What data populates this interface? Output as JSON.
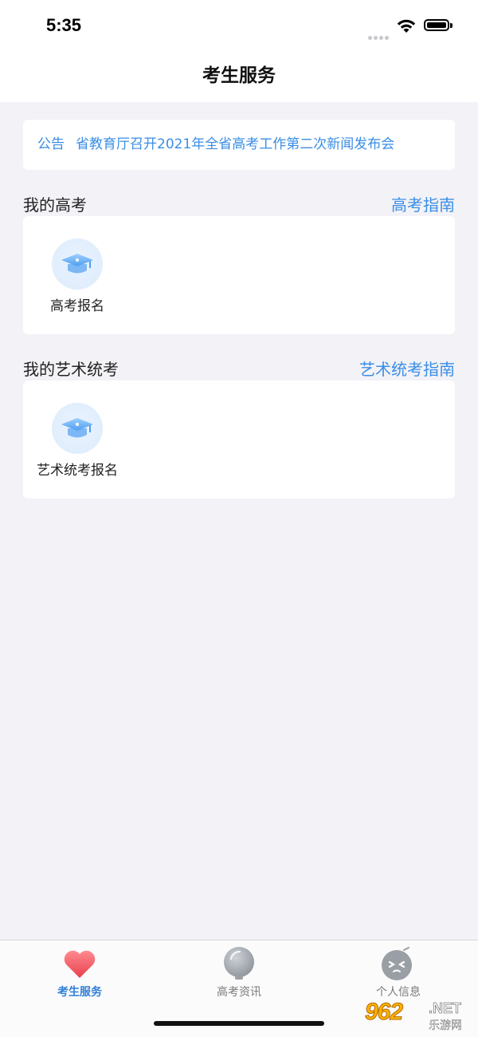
{
  "status_bar": {
    "time": "5:35"
  },
  "nav": {
    "title": "考生服务"
  },
  "notice": {
    "tag": "公告",
    "text": "省教育厅召开2021年全省高考工作第二次新闻发布会"
  },
  "sections": [
    {
      "title": "我的高考",
      "link": "高考指南",
      "entries": [
        {
          "label": "高考报名",
          "icon": "graduation-cap-icon"
        }
      ]
    },
    {
      "title": "我的艺术统考",
      "link": "艺术统考指南",
      "entries": [
        {
          "label": "艺术统考报名",
          "icon": "graduation-cap-icon"
        }
      ]
    }
  ],
  "tabbar": {
    "items": [
      {
        "label": "考生服务",
        "icon": "heart-icon",
        "active": true
      },
      {
        "label": "高考资讯",
        "icon": "lightbulb-icon",
        "active": false
      },
      {
        "label": "个人信息",
        "icon": "face-icon",
        "active": false
      }
    ]
  },
  "watermark": {
    "number": "962",
    "net": ".NET",
    "site": "乐游网"
  },
  "colors": {
    "accent": "#3a8ee6",
    "active_tab": "#2f7fd8",
    "background": "#f2f2f7",
    "heart": "#f25a64"
  }
}
